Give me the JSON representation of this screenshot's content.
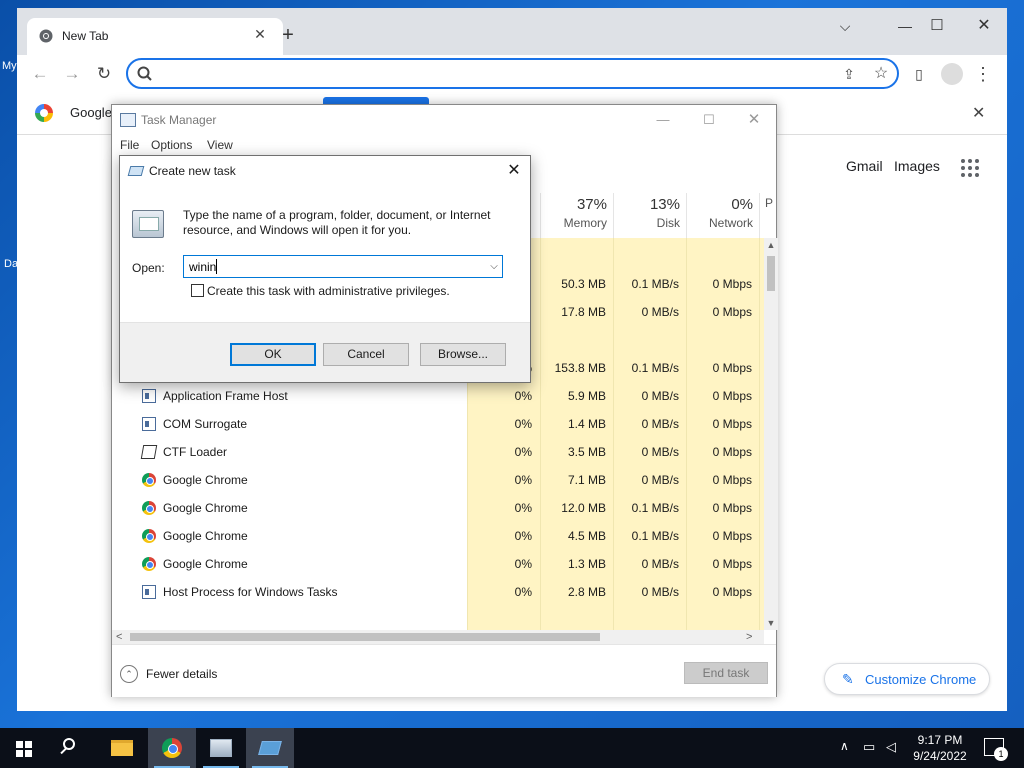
{
  "desktop": {
    "label_1": "My",
    "label_2": "Da"
  },
  "chrome": {
    "tab_title": "New Tab",
    "tab_close": "✕",
    "new_tab": "+",
    "win_dropdown": "⌵",
    "win_min": "—",
    "win_max": "☐",
    "win_close": "✕",
    "back": "←",
    "forward": "→",
    "reload": "↻",
    "omnibox_value": "",
    "share_icon": "⇪",
    "star_icon": "☆",
    "sidepanel_icon": "▯",
    "menu_icon": "⋮",
    "infobar_text": "Google",
    "infobar_close": "✕",
    "gmail": "Gmail",
    "images": "Images",
    "customize": "Customize Chrome",
    "customize_icon": "✎"
  },
  "task_manager": {
    "title": "Task Manager",
    "min": "—",
    "max": "☐",
    "close": "✕",
    "menu": [
      "File",
      "Options",
      "View"
    ],
    "columns": [
      {
        "pct": "37%",
        "name": "Memory"
      },
      {
        "pct": "13%",
        "name": "Disk"
      },
      {
        "pct": "0%",
        "name": "Network"
      },
      {
        "pct": "",
        "name": "P"
      }
    ],
    "rows": [
      {
        "name": "",
        "cpu": "",
        "mem": "",
        "disk": "",
        "net": ""
      },
      {
        "name": "",
        "cpu": "",
        "mem": "50.3 MB",
        "disk": "0.1 MB/s",
        "net": "0 Mbps"
      },
      {
        "name": "",
        "cpu": "",
        "mem": "17.8 MB",
        "disk": "0 MB/s",
        "net": "0 Mbps"
      },
      {
        "name": "",
        "cpu": "",
        "mem": "",
        "disk": "",
        "net": ""
      },
      {
        "name": "Antimalware Service Executable",
        "cpu": "1.1%",
        "mem": "153.8 MB",
        "disk": "0.1 MB/s",
        "net": "0 Mbps"
      },
      {
        "name": "Application Frame Host",
        "cpu": "0%",
        "mem": "5.9 MB",
        "disk": "0 MB/s",
        "net": "0 Mbps"
      },
      {
        "name": "COM Surrogate",
        "cpu": "0%",
        "mem": "1.4 MB",
        "disk": "0 MB/s",
        "net": "0 Mbps"
      },
      {
        "name": "CTF Loader",
        "cpu": "0%",
        "mem": "3.5 MB",
        "disk": "0 MB/s",
        "net": "0 Mbps"
      },
      {
        "name": "Google Chrome",
        "cpu": "0%",
        "mem": "7.1 MB",
        "disk": "0 MB/s",
        "net": "0 Mbps"
      },
      {
        "name": "Google Chrome",
        "cpu": "0%",
        "mem": "12.0 MB",
        "disk": "0.1 MB/s",
        "net": "0 Mbps"
      },
      {
        "name": "Google Chrome",
        "cpu": "0%",
        "mem": "4.5 MB",
        "disk": "0.1 MB/s",
        "net": "0 Mbps"
      },
      {
        "name": "Google Chrome",
        "cpu": "0%",
        "mem": "1.3 MB",
        "disk": "0 MB/s",
        "net": "0 Mbps"
      },
      {
        "name": "Host Process for Windows Tasks",
        "cpu": "0%",
        "mem": "2.8 MB",
        "disk": "0 MB/s",
        "net": "0 Mbps"
      }
    ],
    "fewer_details": "Fewer details",
    "fewer_icon": "⌃",
    "end_task": "End task",
    "scroll_up": "▲",
    "scroll_down": "▼",
    "scroll_left": "<",
    "scroll_right": ">"
  },
  "dialog": {
    "title": "Create new task",
    "close": "✕",
    "description": "Type the name of a program, folder, document, or Internet resource, and Windows will open it for you.",
    "open_label": "Open:",
    "open_value": "winin",
    "dropdown": "⌵",
    "checkbox_label": "Create this task with administrative privileges.",
    "checkbox_checked": false,
    "ok": "OK",
    "cancel": "Cancel",
    "browse": "Browse..."
  },
  "taskbar": {
    "time": "9:17 PM",
    "date": "9/24/2022",
    "notifications": "1",
    "tray_up": "∧",
    "network_icon": "▭",
    "volume_icon": "◁"
  }
}
